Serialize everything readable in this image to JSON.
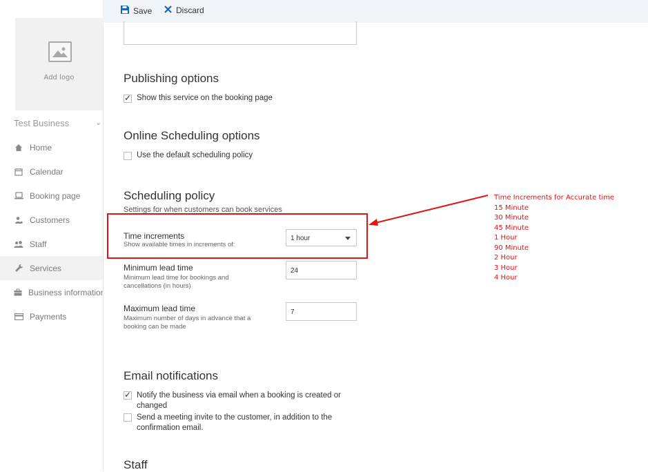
{
  "toolbar": {
    "save_label": "Save",
    "discard_label": "Discard"
  },
  "sidebar": {
    "logo_label": "Add logo",
    "business_name": "Test Business",
    "items": [
      {
        "label": "Home",
        "icon": "home-icon"
      },
      {
        "label": "Calendar",
        "icon": "calendar-icon"
      },
      {
        "label": "Booking page",
        "icon": "laptop-icon"
      },
      {
        "label": "Customers",
        "icon": "customers-icon"
      },
      {
        "label": "Staff",
        "icon": "staff-icon"
      },
      {
        "label": "Services",
        "icon": "wrench-icon",
        "active": true
      },
      {
        "label": "Business information",
        "icon": "briefcase-icon"
      },
      {
        "label": "Payments",
        "icon": "card-icon"
      }
    ]
  },
  "publishing": {
    "title": "Publishing options",
    "show_on_booking_label": "Show this service on the booking page",
    "show_on_booking_checked": true
  },
  "online_scheduling": {
    "title": "Online Scheduling options",
    "default_policy_label": "Use the default scheduling policy",
    "default_policy_checked": false
  },
  "scheduling_policy": {
    "title": "Scheduling policy",
    "subtitle": "Settings for when customers can book services",
    "time_increments": {
      "label": "Time increments",
      "help": "Show available times in increments of:",
      "value": "1 hour"
    },
    "min_lead": {
      "label": "Minimum lead time",
      "help_line1": "Minimum lead time for bookings and",
      "help_line2": "cancellations (in hours)",
      "value": "24"
    },
    "max_lead": {
      "label": "Maximum lead time",
      "help_line1": "Maximum number of days in advance that a",
      "help_line2": "booking can be made",
      "value": "7"
    }
  },
  "email": {
    "title": "Email notifications",
    "notify_line1": "Notify the business via email when a booking is created or",
    "notify_line2": "changed",
    "notify_checked": true,
    "invite_line1": "Send a meeting invite to the customer, in addition to the",
    "invite_line2": "confirmation email.",
    "invite_checked": false
  },
  "staff_section": {
    "title": "Staff"
  },
  "annotation": {
    "color": "#e01414",
    "heading": "Time Increments for Accurate time",
    "options": [
      "15 Minute",
      "30 Minute",
      "45 Minute",
      "1 Hour",
      "90 Minute",
      "2 Hour",
      "3 Hour",
      "4 Hour"
    ]
  }
}
